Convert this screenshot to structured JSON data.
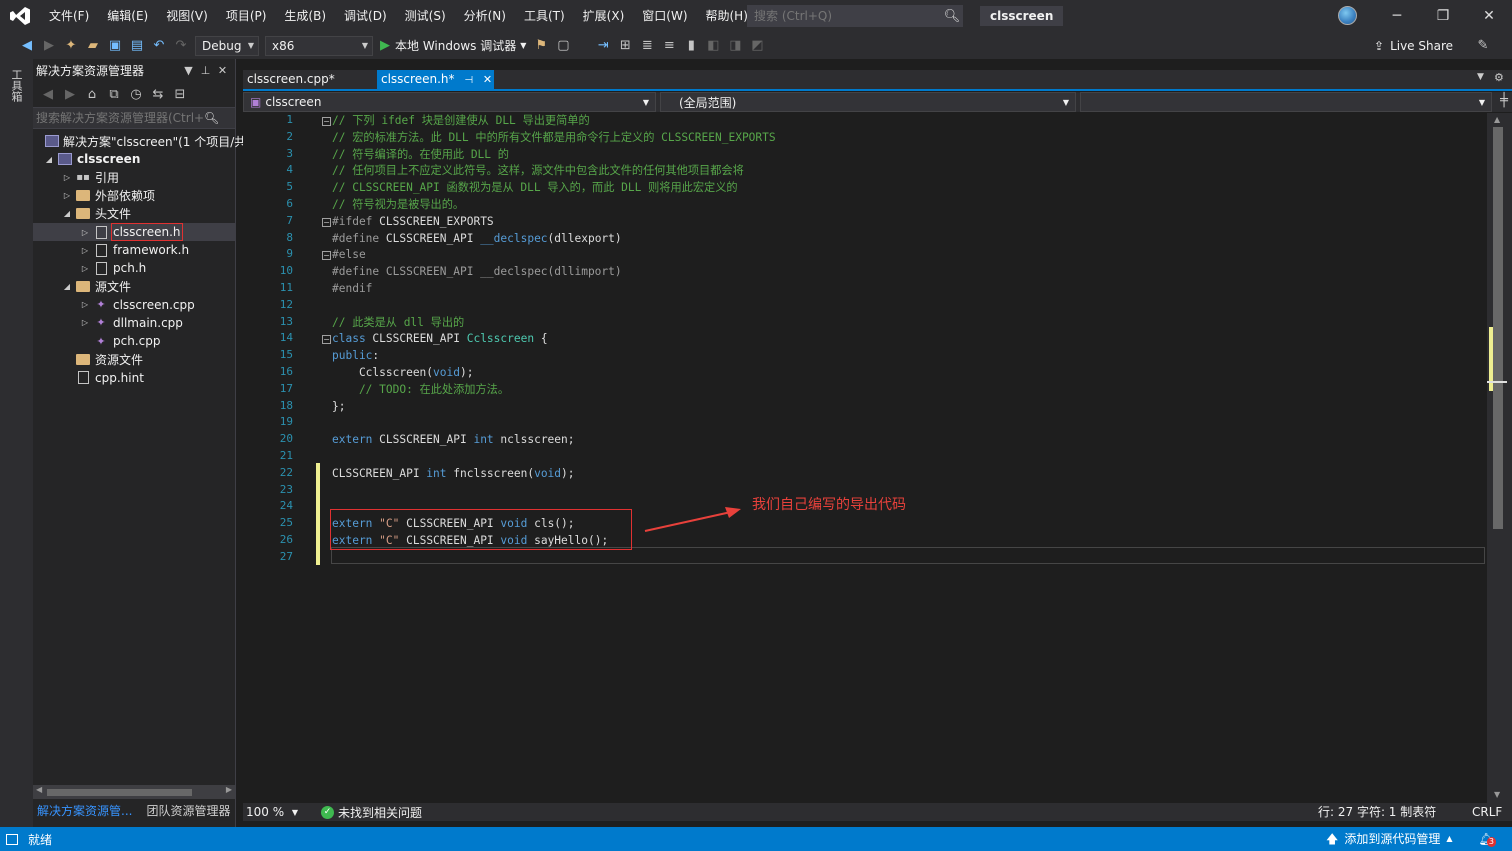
{
  "menu": [
    "文件(F)",
    "编辑(E)",
    "视图(V)",
    "项目(P)",
    "生成(B)",
    "调试(D)",
    "测试(S)",
    "分析(N)",
    "工具(T)",
    "扩展(X)",
    "窗口(W)",
    "帮助(H)"
  ],
  "search": {
    "placeholder": "搜索 (Ctrl+Q)"
  },
  "solution_name": "clsscreen",
  "toolbar": {
    "configuration": "Debug",
    "platform": "x86",
    "run_label": "本地 Windows 调试器",
    "live_share": "Live Share"
  },
  "toolbox_tab": "工具箱",
  "solution_explorer": {
    "title": "解决方案资源管理器",
    "search_placeholder": "搜索解决方案资源管理器(Ctrl+",
    "tree": [
      {
        "label": "解决方案\"clsscreen\"(1 个项目/共",
        "kind": "solution",
        "indent": 0,
        "expander": ""
      },
      {
        "label": "clsscreen",
        "kind": "project",
        "indent": 0,
        "expander": "◢"
      },
      {
        "label": "引用",
        "kind": "references",
        "indent": 1,
        "expander": "▷"
      },
      {
        "label": "外部依赖项",
        "kind": "folder",
        "indent": 1,
        "expander": "▷"
      },
      {
        "label": "头文件",
        "kind": "folder",
        "indent": 1,
        "expander": "◢"
      },
      {
        "label": "clsscreen.h",
        "kind": "file",
        "indent": 2,
        "expander": "▷"
      },
      {
        "label": "framework.h",
        "kind": "file",
        "indent": 2,
        "expander": "▷"
      },
      {
        "label": "pch.h",
        "kind": "file",
        "indent": 2,
        "expander": "▷"
      },
      {
        "label": "源文件",
        "kind": "folder",
        "indent": 1,
        "expander": "◢"
      },
      {
        "label": "clsscreen.cpp",
        "kind": "cpp",
        "indent": 2,
        "expander": "▷"
      },
      {
        "label": "dllmain.cpp",
        "kind": "cpp",
        "indent": 2,
        "expander": "▷"
      },
      {
        "label": "pch.cpp",
        "kind": "cpp",
        "indent": 2,
        "expander": ""
      },
      {
        "label": "资源文件",
        "kind": "folder",
        "indent": 1,
        "expander": ""
      },
      {
        "label": "cpp.hint",
        "kind": "file",
        "indent": 1,
        "expander": ""
      }
    ],
    "bottom_tabs": [
      "解决方案资源管...",
      "团队资源管理器"
    ]
  },
  "doc_tabs": [
    {
      "label": "clsscreen.cpp*",
      "active": false
    },
    {
      "label": "clsscreen.h*",
      "active": true
    }
  ],
  "nav_bar": {
    "scope_left": "clsscreen",
    "scope_right": "(全局范围)"
  },
  "editor": {
    "lines": [
      [
        [
          "c",
          "// 下列 ifdef 块是创建使从 DLL 导出更简单的"
        ]
      ],
      [
        [
          "c",
          "// 宏的标准方法。此 DLL 中的所有文件都是用命令行上定义的 CLSSCREEN_EXPORTS"
        ]
      ],
      [
        [
          "c",
          "// 符号编译的。在使用此 DLL 的"
        ]
      ],
      [
        [
          "c",
          "// 任何项目上不应定义此符号。这样，源文件中包含此文件的任何其他项目都会将"
        ]
      ],
      [
        [
          "c",
          "// CLSSCREEN_API 函数视为是从 DLL 导入的，而此 DLL 则将用此宏定义的"
        ]
      ],
      [
        [
          "c",
          "// 符号视为是被导出的。"
        ]
      ],
      [
        [
          "g",
          "#ifdef "
        ],
        [
          "n",
          "CLSSCREEN_EXPORTS"
        ]
      ],
      [
        [
          "g",
          "#define "
        ],
        [
          "n",
          "CLSSCREEN_API "
        ],
        [
          "k",
          "__declspec"
        ],
        [
          "n",
          "(dllexport)"
        ]
      ],
      [
        [
          "g",
          "#else"
        ]
      ],
      [
        [
          "g",
          "#define CLSSCREEN_API __declspec(dllimport)"
        ]
      ],
      [
        [
          "g",
          "#endif"
        ]
      ],
      [
        [
          "n",
          ""
        ]
      ],
      [
        [
          "c",
          "// 此类是从 dll 导出的"
        ]
      ],
      [
        [
          "k",
          "class "
        ],
        [
          "n",
          "CLSSCREEN_API "
        ],
        [
          "t",
          "Cclsscreen"
        ],
        [
          "n",
          " {"
        ]
      ],
      [
        [
          "k",
          "public"
        ],
        [
          "n",
          ":"
        ]
      ],
      [
        [
          "n",
          "    Cclsscreen("
        ],
        [
          "k",
          "void"
        ],
        [
          "n",
          ");"
        ]
      ],
      [
        [
          "c",
          "    // TODO: 在此处添加方法。"
        ]
      ],
      [
        [
          "n",
          "};"
        ]
      ],
      [
        [
          "n",
          ""
        ]
      ],
      [
        [
          "k",
          "extern "
        ],
        [
          "n",
          "CLSSCREEN_API "
        ],
        [
          "k",
          "int "
        ],
        [
          "n",
          "nclsscreen;"
        ]
      ],
      [
        [
          "n",
          ""
        ]
      ],
      [
        [
          "n",
          "CLSSCREEN_API "
        ],
        [
          "k",
          "int "
        ],
        [
          "n",
          "fnclsscreen("
        ],
        [
          "k",
          "void"
        ],
        [
          "n",
          ");"
        ]
      ],
      [
        [
          "n",
          ""
        ]
      ],
      [
        [
          "n",
          ""
        ]
      ],
      [
        [
          "k",
          "extern "
        ],
        [
          "s",
          "\"C\" "
        ],
        [
          "n",
          "CLSSCREEN_API "
        ],
        [
          "k",
          "void "
        ],
        [
          "n",
          "cls();"
        ]
      ],
      [
        [
          "k",
          "extern "
        ],
        [
          "s",
          "\"C\" "
        ],
        [
          "n",
          "CLSSCREEN_API "
        ],
        [
          "k",
          "void "
        ],
        [
          "n",
          "sayHello();"
        ]
      ],
      [
        [
          "n",
          ""
        ]
      ]
    ],
    "annotation": "我们自己编写的导出代码"
  },
  "editor_status": {
    "zoom": "100 %",
    "issues": "未找到相关问题",
    "cursor": "行: 27   字符: 1   制表符",
    "line_ending": "CRLF"
  },
  "statusbar": {
    "ready": "就绪",
    "source_control": "添加到源代码管理",
    "notifications": "3"
  },
  "colors": {
    "accent": "#007acc",
    "annotation_red": "#e03131"
  }
}
